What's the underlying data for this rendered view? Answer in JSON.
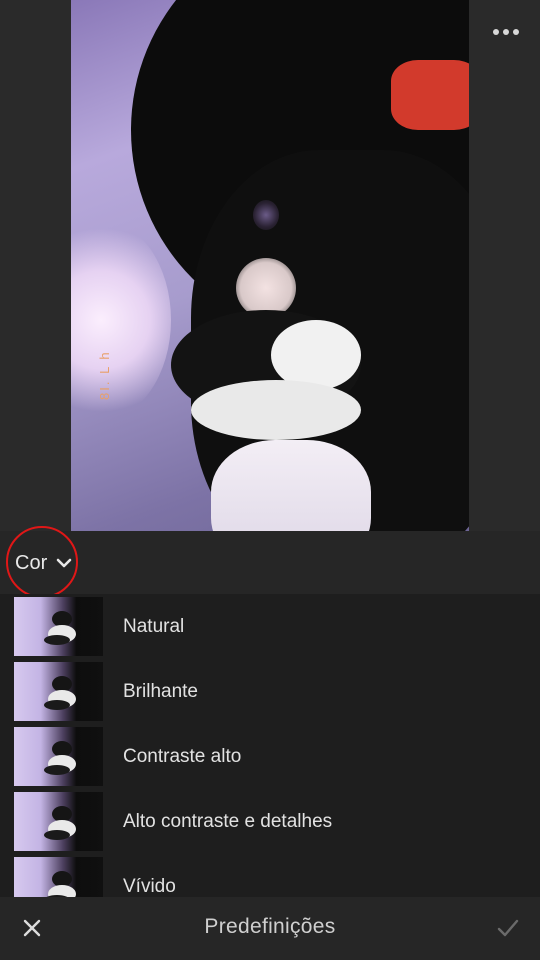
{
  "menu": {
    "more_icon": "more-horizontal-icon"
  },
  "photo": {
    "description_icon": "photo-preview",
    "watermark_text": "8I. L h"
  },
  "category": {
    "label": "Cor",
    "icon": "chevron-down-icon",
    "highlight_color": "#e01717"
  },
  "presets": [
    {
      "label": "Natural"
    },
    {
      "label": "Brilhante"
    },
    {
      "label": "Contraste alto"
    },
    {
      "label": "Alto contraste e detalhes"
    },
    {
      "label": "Vívido"
    }
  ],
  "bottom_bar": {
    "title": "Predefinições",
    "close_icon": "close-icon",
    "confirm_icon": "check-icon"
  },
  "colors": {
    "background": "#1e1e1e",
    "bar": "#262626",
    "text": "#e2e2e2"
  }
}
